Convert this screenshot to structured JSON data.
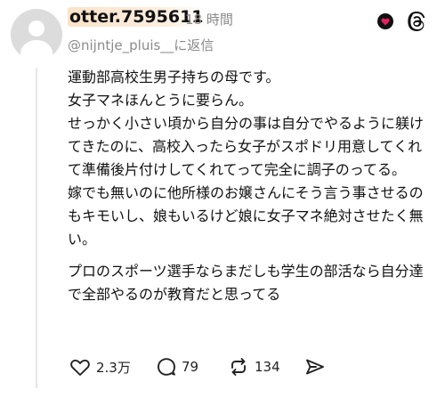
{
  "author": {
    "username": "otter.7595611",
    "time": "18 時間",
    "reply_to": "@nijntje_pluis__に返信"
  },
  "post": {
    "paragraphs": [
      "運動部高校生男子持ちの母です。",
      "女子マネほんとうに要らん。",
      "せっかく小さい頃から自分の事は自分でやるように躾けてきたのに、高校入ったら女子がスポドリ用意してくれて準備後片付けしてくれてって完全に調子のってる。",
      "嫁でも無いのに他所様のお嬢さんにそう言う事させるのもキモいし、娘もいるけど娘に女子マネ絶対させたく無い。",
      "プロのスポーツ選手ならまだしも学生の部活なら自分達で全部やるのが教育だと思ってる"
    ]
  },
  "actions": {
    "likes": "2.3万",
    "comments": "79",
    "reposts": "134"
  },
  "icons": {
    "like": "heart-outline-icon",
    "comment": "speech-bubble-icon",
    "repost": "repost-icon",
    "share": "send-icon",
    "badge": "heart-follow-badge-icon",
    "app": "threads-logo-icon"
  },
  "colors": {
    "badge_red": "#e0245e",
    "muted_text": "#8a8a8a"
  }
}
